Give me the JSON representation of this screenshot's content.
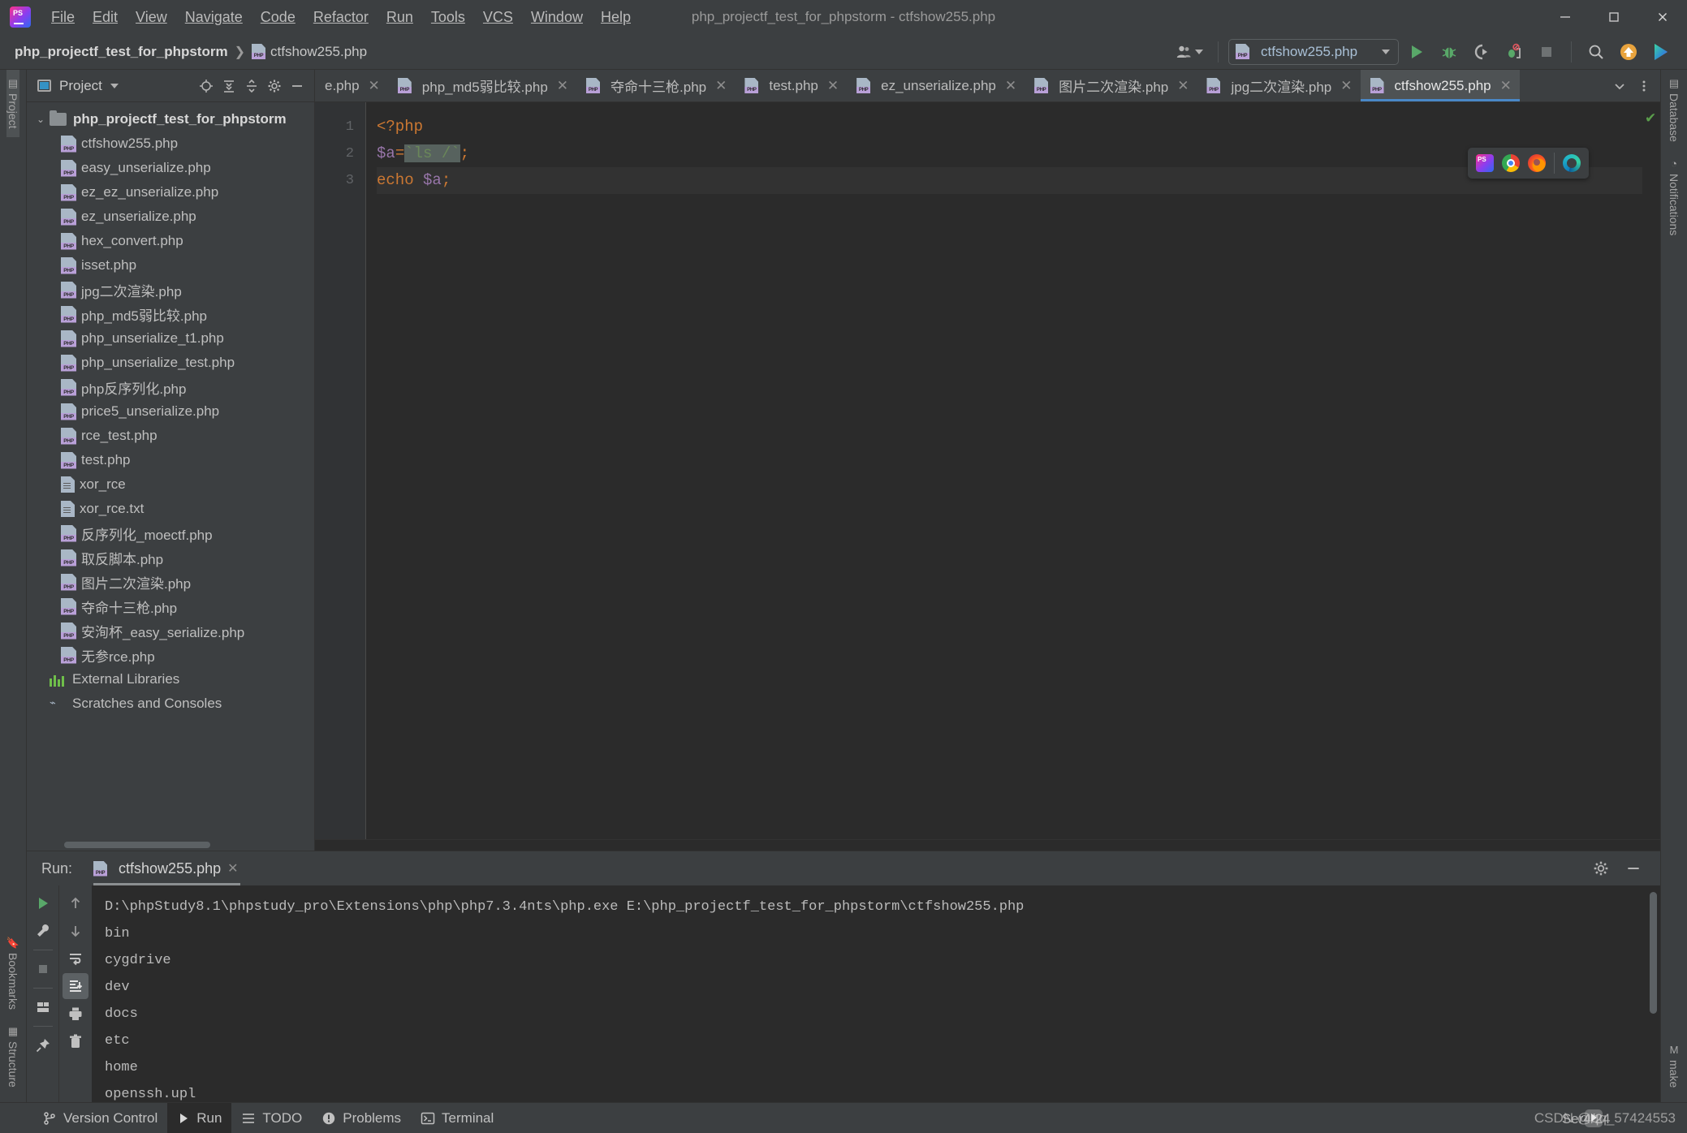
{
  "window": {
    "title": "php_projectf_test_for_phpstorm - ctfshow255.php",
    "minimize": "–",
    "maximize": "☐",
    "close": "✕"
  },
  "menu": {
    "items": [
      {
        "label": "File"
      },
      {
        "label": "Edit"
      },
      {
        "label": "View"
      },
      {
        "label": "Navigate"
      },
      {
        "label": "Code"
      },
      {
        "label": "Refactor"
      },
      {
        "label": "Run"
      },
      {
        "label": "Tools"
      },
      {
        "label": "VCS"
      },
      {
        "label": "Window"
      },
      {
        "label": "Help"
      }
    ]
  },
  "navbar": {
    "project_name": "php_projectf_test_for_phpstorm",
    "separator": "❯",
    "current_file": "ctfshow255.php",
    "run_config": "ctfshow255.php",
    "run_config_dropdown": "▾"
  },
  "left_rail": {
    "top": [
      {
        "label": "Project"
      }
    ],
    "bottom": [
      {
        "label": "Bookmarks"
      },
      {
        "label": "Structure"
      }
    ]
  },
  "right_rail": {
    "top": [
      {
        "label": "Database"
      },
      {
        "label": "Notifications"
      }
    ],
    "bottom": [
      {
        "label": "make"
      }
    ]
  },
  "project_panel": {
    "title": "Project",
    "tree": [
      {
        "label": "php_projectf_test_for_phpstorm",
        "type": "folder",
        "depth": 0,
        "expanded": true
      },
      {
        "label": "ctfshow255.php",
        "type": "php",
        "depth": 1
      },
      {
        "label": "easy_unserialize.php",
        "type": "php",
        "depth": 1
      },
      {
        "label": "ez_ez_unserialize.php",
        "type": "php",
        "depth": 1
      },
      {
        "label": "ez_unserialize.php",
        "type": "php",
        "depth": 1
      },
      {
        "label": "hex_convert.php",
        "type": "php",
        "depth": 1
      },
      {
        "label": "isset.php",
        "type": "php",
        "depth": 1
      },
      {
        "label": "jpg二次渲染.php",
        "type": "php",
        "depth": 1
      },
      {
        "label": "php_md5弱比较.php",
        "type": "php",
        "depth": 1
      },
      {
        "label": "php_unserialize_t1.php",
        "type": "php",
        "depth": 1
      },
      {
        "label": "php_unserialize_test.php",
        "type": "php",
        "depth": 1
      },
      {
        "label": "php反序列化.php",
        "type": "php",
        "depth": 1
      },
      {
        "label": "price5_unserialize.php",
        "type": "php",
        "depth": 1
      },
      {
        "label": "rce_test.php",
        "type": "php",
        "depth": 1
      },
      {
        "label": "test.php",
        "type": "php",
        "depth": 1
      },
      {
        "label": "xor_rce",
        "type": "txt",
        "depth": 1
      },
      {
        "label": "xor_rce.txt",
        "type": "txt",
        "depth": 1
      },
      {
        "label": "反序列化_moectf.php",
        "type": "php",
        "depth": 1
      },
      {
        "label": "取反脚本.php",
        "type": "php",
        "depth": 1
      },
      {
        "label": "图片二次渲染.php",
        "type": "php",
        "depth": 1
      },
      {
        "label": "夺命十三枪.php",
        "type": "php",
        "depth": 1
      },
      {
        "label": "安洵杯_easy_serialize.php",
        "type": "php",
        "depth": 1
      },
      {
        "label": "无参rce.php",
        "type": "php",
        "depth": 1
      },
      {
        "label": "External Libraries",
        "type": "libs",
        "depth": 0
      },
      {
        "label": "Scratches and Consoles",
        "type": "scratches",
        "depth": 0
      }
    ]
  },
  "editor": {
    "tabs": [
      {
        "label": "e.php",
        "active": false,
        "clipped": true
      },
      {
        "label": "php_md5弱比较.php",
        "active": false
      },
      {
        "label": "夺命十三枪.php",
        "active": false
      },
      {
        "label": "test.php",
        "active": false
      },
      {
        "label": "ez_unserialize.php",
        "active": false
      },
      {
        "label": "图片二次渲染.php",
        "active": false
      },
      {
        "label": "jpg二次渲染.php",
        "active": false
      },
      {
        "label": "ctfshow255.php",
        "active": true
      }
    ],
    "tab_close": "✕",
    "line_numbers": [
      "1",
      "2",
      "3"
    ],
    "code_lines": [
      {
        "n": 1,
        "tokens": [
          {
            "t": "<?php",
            "c": "kw"
          }
        ]
      },
      {
        "n": 2,
        "tokens": [
          {
            "t": "$a",
            "c": "var"
          },
          {
            "t": "=",
            "c": "punc"
          },
          {
            "t": "`ls /`",
            "c": "shellexec"
          },
          {
            "t": ";",
            "c": "punc"
          }
        ]
      },
      {
        "n": 3,
        "tokens": [
          {
            "t": "echo ",
            "c": "kw"
          },
          {
            "t": "$a",
            "c": "var"
          },
          {
            "t": ";",
            "c": "punc"
          }
        ]
      }
    ],
    "inspection_status": "✔",
    "browser_popup": [
      {
        "name": "phpstorm"
      },
      {
        "name": "chrome"
      },
      {
        "name": "firefox"
      },
      {
        "name": "edge"
      }
    ]
  },
  "run_panel": {
    "label": "Run:",
    "tab_name": "ctfshow255.php",
    "tab_close": "✕",
    "console_lines": [
      "D:\\phpStudy8.1\\phpstudy_pro\\Extensions\\php\\php7.3.4nts\\php.exe E:\\php_projectf_test_for_phpstorm\\ctfshow255.php",
      "bin",
      "cygdrive",
      "dev",
      "docs",
      "etc",
      "home",
      "openssh.upl"
    ]
  },
  "status_bar": {
    "items": [
      {
        "label": "Version Control",
        "icon": "branch-icon",
        "active": false
      },
      {
        "label": "Run",
        "icon": "play-icon",
        "active": true
      },
      {
        "label": "TODO",
        "icon": "list-icon",
        "active": false
      },
      {
        "label": "Problems",
        "icon": "warning-icon",
        "active": false
      },
      {
        "label": "Terminal",
        "icon": "terminal-icon",
        "active": false
      }
    ],
    "watermark": "CSDN @qq_57424553",
    "watermark_overlay": "Ser4/24"
  },
  "colors": {
    "bg": "#3c3f41",
    "editor_bg": "#2b2b2b",
    "accent": "#4a88c7",
    "keyword": "#cc7832",
    "variable": "#9876aa",
    "string": "#6a8759"
  }
}
